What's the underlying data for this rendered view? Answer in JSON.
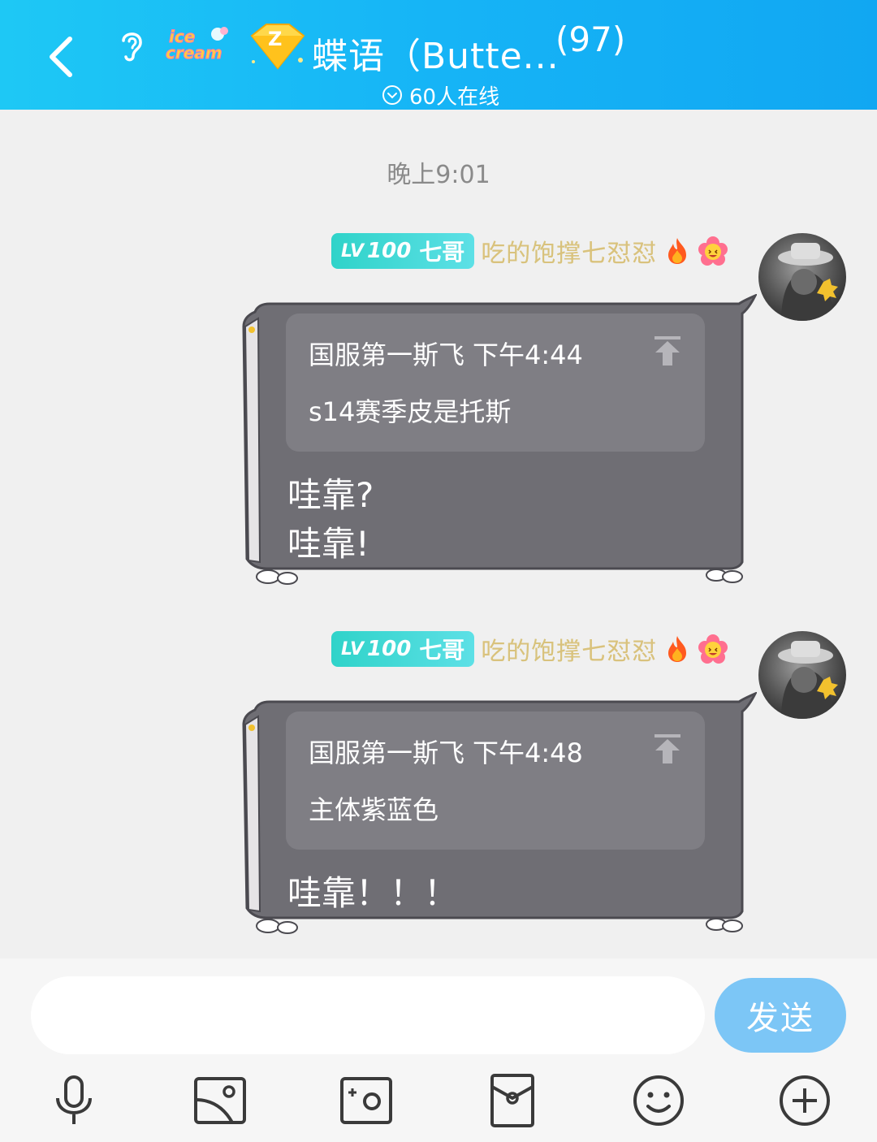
{
  "header": {
    "group_name": "蝶语（Butte...",
    "member_count": "(97)",
    "online_status": "60人在线"
  },
  "chat": {
    "timestamp": "晚上9:01",
    "messages": [
      {
        "level_prefix": "LV",
        "level": "100",
        "title": "七哥",
        "nickname": "吃的饱撑七怼怼",
        "quote_author": "国服第一斯飞",
        "quote_time": "下午4:44",
        "quote_text": "s14赛季皮是托斯",
        "lines": [
          "哇靠?",
          "哇靠!"
        ]
      },
      {
        "level_prefix": "LV",
        "level": "100",
        "title": "七哥",
        "nickname": "吃的饱撑七怼怼",
        "quote_author": "国服第一斯飞",
        "quote_time": "下午4:48",
        "quote_text": "主体紫蓝色",
        "lines": [
          "哇靠！！！"
        ]
      }
    ]
  },
  "input": {
    "value": "",
    "send_label": "发送"
  },
  "toolbar_icons": [
    "microphone-icon",
    "image-icon",
    "camera-icon",
    "red-packet-icon",
    "emoji-icon",
    "plus-icon"
  ],
  "colors": {
    "header_blue": "#16b4f6",
    "bubble_gray": "#6f6e74",
    "send_button": "#7cc6f6",
    "level_badge": "#2fd3c9"
  }
}
